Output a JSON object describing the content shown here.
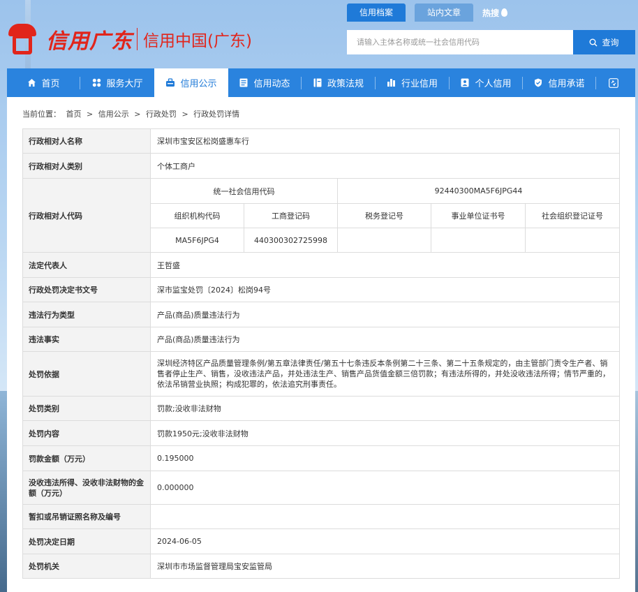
{
  "brand": {
    "logo_script": "信用广东",
    "logo_text": "信用中国(广东)"
  },
  "top_tabs": [
    {
      "label": "信用档案"
    },
    {
      "label": "站内文章"
    }
  ],
  "hot_search": "热搜",
  "search": {
    "placeholder": "请输入主体名称或统一社会信用代码",
    "button": "查询"
  },
  "nav": [
    {
      "label": "首页",
      "icon": "home-icon"
    },
    {
      "label": "服务大厅",
      "icon": "grid-icon"
    },
    {
      "label": "信用公示",
      "icon": "publicity-icon"
    },
    {
      "label": "信用动态",
      "icon": "news-icon"
    },
    {
      "label": "政策法规",
      "icon": "book-icon"
    },
    {
      "label": "行业信用",
      "icon": "industry-icon"
    },
    {
      "label": "个人信用",
      "icon": "person-icon"
    },
    {
      "label": "信用承诺",
      "icon": "shield-icon"
    }
  ],
  "breadcrumb": {
    "prefix": "当前位置：",
    "items": [
      "首页",
      "信用公示",
      "行政处罚",
      "行政处罚详情"
    ],
    "sep": ">"
  },
  "detail": {
    "name_label": "行政相对人名称",
    "name": "深圳市宝安区松岗盛惠车行",
    "type_label": "行政相对人类别",
    "type": "个体工商户",
    "code_label": "行政相对人代码",
    "uscc_label": "统一社会信用代码",
    "uscc": "92440300MA5F6JPG44",
    "org_code_label": "组织机构代码",
    "biz_reg_label": "工商登记码",
    "tax_reg_label": "税务登记号",
    "inst_cert_label": "事业单位证书号",
    "social_org_label": "社会组织登记证号",
    "org_code": "MA5F6JPG4",
    "biz_reg": "440300302725998",
    "tax_reg": "",
    "inst_cert": "",
    "social_org": "",
    "legal_rep_label": "法定代表人",
    "legal_rep": "王哲盛",
    "doc_no_label": "行政处罚决定书文号",
    "doc_no": "深市监宝处罚〔2024〕松岗94号",
    "violation_type_label": "违法行为类型",
    "violation_type": "产品(商品)质量违法行为",
    "facts_label": "违法事实",
    "facts": "产品(商品)质量违法行为",
    "basis_label": "处罚依据",
    "basis": "深圳经济特区产品质量管理条例/第五章法律责任/第五十七条违反本条例第二十三条、第二十五条规定的，由主管部门责令生产者、销售者停止生产、销售，没收违法产品，并处违法生产、销售产品货值金额三倍罚款；有违法所得的，并处没收违法所得；情节严重的，依法吊销营业执照；构成犯罪的，依法追究刑事责任。",
    "category_label": "处罚类别",
    "category": "罚款;没收非法财物",
    "content_label": "处罚内容",
    "content": "罚款1950元;没收非法财物",
    "fine_label": "罚款金额（万元）",
    "fine": "0.195000",
    "confiscate_label": "没收违法所得、没收非法财物的金额（万元）",
    "confiscate": "0.000000",
    "license_label": "暂扣或吊销证照名称及编号",
    "license": "",
    "date_label": "处罚决定日期",
    "date": "2024-06-05",
    "authority_label": "处罚机关",
    "authority": "深圳市市场监督管理局宝安监管局"
  }
}
